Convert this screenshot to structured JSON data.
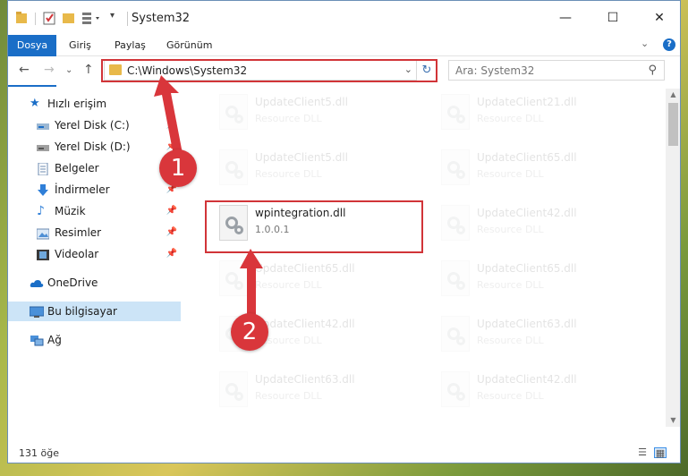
{
  "window": {
    "title": "System32"
  },
  "ribbon": {
    "tabs": [
      "Dosya",
      "Giriş",
      "Paylaş",
      "Görünüm"
    ]
  },
  "address": {
    "path": "C:\\Windows\\System32"
  },
  "search": {
    "placeholder": "Ara: System32"
  },
  "sidebar": {
    "items": [
      {
        "label": "Hızlı erişim",
        "icon": "star-icon"
      },
      {
        "label": "Yerel Disk (C:)",
        "icon": "drive-icon",
        "pinned": true
      },
      {
        "label": "Yerel Disk (D:)",
        "icon": "drive-icon",
        "pinned": true
      },
      {
        "label": "Belgeler",
        "icon": "documents-icon",
        "pinned": true
      },
      {
        "label": "İndirmeler",
        "icon": "downloads-icon",
        "pinned": true
      },
      {
        "label": "Müzik",
        "icon": "music-icon",
        "pinned": true
      },
      {
        "label": "Resimler",
        "icon": "pictures-icon",
        "pinned": true
      },
      {
        "label": "Videolar",
        "icon": "videos-icon",
        "pinned": true
      },
      {
        "label": "OneDrive",
        "icon": "cloud-icon"
      },
      {
        "label": "Bu bilgisayar",
        "icon": "computer-icon",
        "selected": true
      },
      {
        "label": "Ağ",
        "icon": "network-icon"
      }
    ]
  },
  "files": [
    {
      "name": "UpdateClient5.dll",
      "desc": "Resource DLL"
    },
    {
      "name": "UpdateClient21.dll",
      "desc": "Resource DLL"
    },
    {
      "name": "UpdateClient5.dll",
      "desc": "Resource DLL"
    },
    {
      "name": "UpdateClient65.dll",
      "desc": "Resource DLL"
    },
    {
      "name": "wpintegration.dll",
      "desc": "1.0.0.1"
    },
    {
      "name": "UpdateClient42.dll",
      "desc": "Resource DLL"
    },
    {
      "name": "UpdateClient65.dll",
      "desc": "Resource DLL"
    },
    {
      "name": "UpdateClient65.dll",
      "desc": "Resource DLL"
    },
    {
      "name": "UpdateClient42.dll",
      "desc": "Resource DLL"
    },
    {
      "name": "UpdateClient63.dll",
      "desc": "Resource DLL"
    },
    {
      "name": "UpdateClient63.dll",
      "desc": "Resource DLL"
    },
    {
      "name": "UpdateClient42.dll",
      "desc": "Resource DLL"
    }
  ],
  "status": {
    "count": "131 öğe"
  },
  "annotations": {
    "step1": "1",
    "step2": "2"
  },
  "colors": {
    "accent": "#1a6ec7",
    "highlight": "#d13438"
  }
}
